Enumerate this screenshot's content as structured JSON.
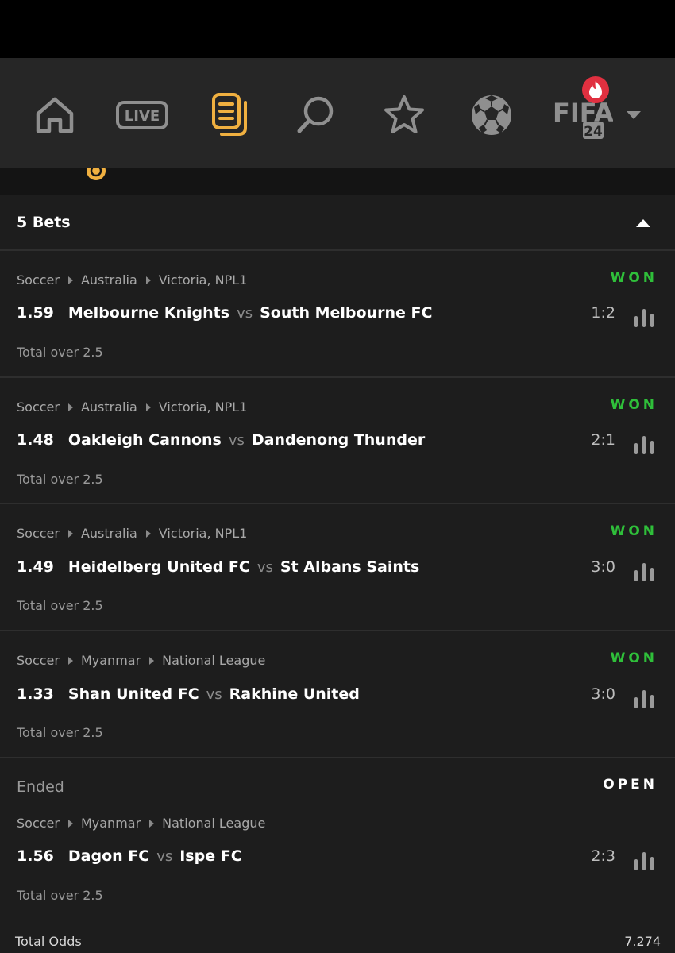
{
  "nav": {
    "items": [
      {
        "name": "home",
        "icon": "home-icon"
      },
      {
        "name": "live",
        "icon": "live-icon",
        "label": "LIVE"
      },
      {
        "name": "bets",
        "icon": "betslip-icon",
        "active": true
      },
      {
        "name": "search",
        "icon": "search-icon"
      },
      {
        "name": "favorites",
        "icon": "star-icon"
      },
      {
        "name": "soccer",
        "icon": "soccer-ball-icon"
      },
      {
        "name": "fifa",
        "icon": "fifa-24-icon",
        "label_top": "FIFA",
        "label_bottom": "24",
        "badge": "fire-icon"
      }
    ],
    "more": "chevron-down-icon"
  },
  "colors": {
    "accent": "#f0b040",
    "won": "#2fbf3a",
    "badge": "#e03040"
  },
  "slip": {
    "title": "5 Bets",
    "bets": [
      {
        "sport": "Soccer",
        "country": "Australia",
        "league": "Victoria, NPL1",
        "status": "WON",
        "odds": "1.59",
        "home": "Melbourne Knights",
        "vs": "vs",
        "away": "South Melbourne FC",
        "score": "1:2",
        "market": "Total over 2.5"
      },
      {
        "sport": "Soccer",
        "country": "Australia",
        "league": "Victoria, NPL1",
        "status": "WON",
        "odds": "1.48",
        "home": "Oakleigh Cannons",
        "vs": "vs",
        "away": "Dandenong Thunder",
        "score": "2:1",
        "market": "Total over 2.5"
      },
      {
        "sport": "Soccer",
        "country": "Australia",
        "league": "Victoria, NPL1",
        "status": "WON",
        "odds": "1.49",
        "home": "Heidelberg United FC",
        "vs": "vs",
        "away": "St Albans Saints",
        "score": "3:0",
        "market": "Total over 2.5"
      },
      {
        "sport": "Soccer",
        "country": "Myanmar",
        "league": "National League",
        "status": "WON",
        "odds": "1.33",
        "home": "Shan United FC",
        "vs": "vs",
        "away": "Rakhine United",
        "score": "3:0",
        "market": "Total over 2.5"
      },
      {
        "state": "Ended",
        "sport": "Soccer",
        "country": "Myanmar",
        "league": "National League",
        "status": "OPEN",
        "odds": "1.56",
        "home": "Dagon FC",
        "vs": "vs",
        "away": "Ispe FC",
        "score": "2:3",
        "market": "Total over 2.5"
      }
    ],
    "total_label": "Total Odds",
    "total_value": "7.274"
  }
}
